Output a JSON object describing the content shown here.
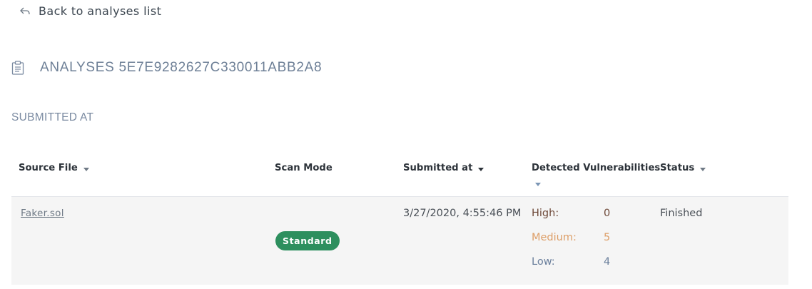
{
  "nav": {
    "back_label": "Back to analyses list",
    "back_icon": "reply-arrow-icon"
  },
  "header": {
    "title": "ANALYSES 5E7E9282627C330011ABB2A8",
    "icon": "clipboard-icon"
  },
  "section": {
    "label": "SUBMITTED AT"
  },
  "table": {
    "columns": [
      "Source File",
      "Scan Mode",
      "Submitted at",
      "Detected Vulnerabilities",
      "Status"
    ],
    "rows": [
      {
        "source_file": "Faker.sol",
        "scan_mode": "Standard",
        "submitted_at": "3/27/2020, 4:55:46 PM",
        "vulnerabilities": {
          "high_label": "High:",
          "high": "0",
          "medium_label": "Medium:",
          "medium": "5",
          "low_label": "Low:",
          "low": "4"
        },
        "status": "Finished"
      }
    ]
  },
  "colors": {
    "badge": "#2d8f5e",
    "high": "#6f4a3a",
    "medium": "#dd9e67",
    "low": "#6a7f9c",
    "title": "#6d7f96"
  }
}
